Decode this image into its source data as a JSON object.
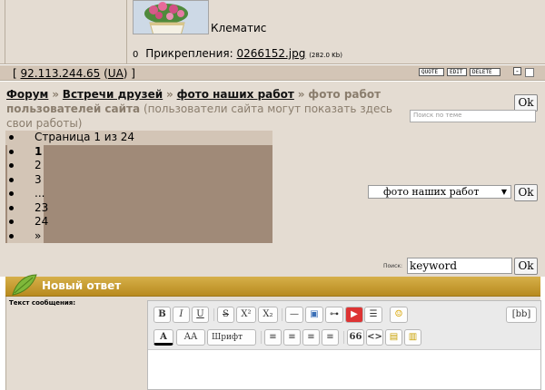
{
  "post": {
    "photo_caption": "Клематис",
    "attach_label": "Прикрепления:",
    "attach_file": "0266152.jpg",
    "attach_size": "(282.0 Kb)"
  },
  "ip_bar": {
    "prefix": "[ ",
    "ip": "92.113.244.65",
    "country_open": " (",
    "country": "UA",
    "country_close": ") ]",
    "quote_label": "QUOTE",
    "edit_label": "EDIT",
    "delete_label": "DELETE",
    "collapse_label": "-"
  },
  "breadcrumb": {
    "forum": "Форум",
    "sep": "»",
    "section": "Встречи друзей",
    "subforum": "фото наших работ",
    "current": "фото работ пользователей сайта",
    "description": "(пользователи сайта могут показать здесь свои работы)"
  },
  "topic_search": {
    "placeholder": "Поиск по теме",
    "ok_label": "Ok"
  },
  "pager": {
    "items": [
      {
        "text": "Страница 1 из 24",
        "bold": false
      },
      {
        "text": "1",
        "bold": true
      },
      {
        "text": "2",
        "bold": false
      },
      {
        "text": "3",
        "bold": false
      },
      {
        "text": "...",
        "bold": false
      },
      {
        "text": "23",
        "bold": false
      },
      {
        "text": "24",
        "bold": false
      },
      {
        "text": "»",
        "bold": false
      }
    ]
  },
  "jump": {
    "selected": "фото наших работ",
    "ok_label": "Ok"
  },
  "keyword_search": {
    "label": "Поиск:",
    "value": "keyword",
    "ok_label": "Ok"
  },
  "reply": {
    "title": "Новый ответ",
    "message_label": "Текст сообщения:",
    "toolbar": {
      "bold": "B",
      "italic": "I",
      "underline": "U",
      "strike": "S",
      "sup": "X²",
      "sub": "X₂",
      "hr": "—",
      "img": "▣",
      "link": "⊶",
      "youtube": "▶",
      "list": "☰",
      "smile": "☺",
      "bbcode": "[bb]",
      "color": "A",
      "size": "AA",
      "font": "Шрифт",
      "quote": "66",
      "code": "<>"
    }
  },
  "colors": {
    "page_bg": "#e4dcd2",
    "bar_bg": "#d3c5b6",
    "pager_bg": "#a08a78",
    "reply_header": "#c79a2c",
    "muted_text": "#8a7d6d"
  }
}
